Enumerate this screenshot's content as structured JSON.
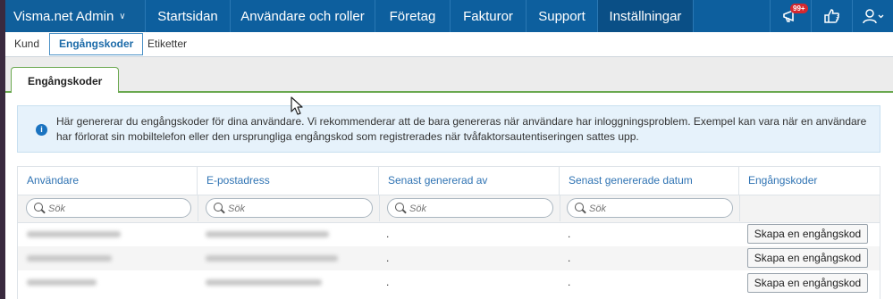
{
  "nav": {
    "brand": "Visma.net Admin",
    "items": [
      "Startsidan",
      "Användare och roller",
      "Företag",
      "Fakturor",
      "Support",
      "Inställningar"
    ],
    "notification_count": "99+"
  },
  "subtabs": [
    "Kund",
    "Engångskoder",
    "Etiketter"
  ],
  "page_tab": "Engångskoder",
  "info_text": "Här genererar du engångskoder för dina användare. Vi rekommenderar att de bara genereras när användare har inloggningsproblem. Exempel kan vara när en användare har förlorat sin mobiltelefon eller den ursprungliga engångskod som registrerades när tvåfaktorsautentiseringen sattes upp.",
  "table": {
    "headers": [
      "Användare",
      "E-postadress",
      "Senast genererad av",
      "Senast genererade datum",
      "Engångskoder"
    ],
    "search_placeholder": "Sök",
    "rows": [
      {
        "generated_by": ".",
        "date": ".",
        "action": "Skapa en engångskod"
      },
      {
        "generated_by": ".",
        "date": ".",
        "action": "Skapa en engångskod"
      },
      {
        "generated_by": ".",
        "date": ".",
        "action": "Skapa en engångskod"
      }
    ]
  }
}
